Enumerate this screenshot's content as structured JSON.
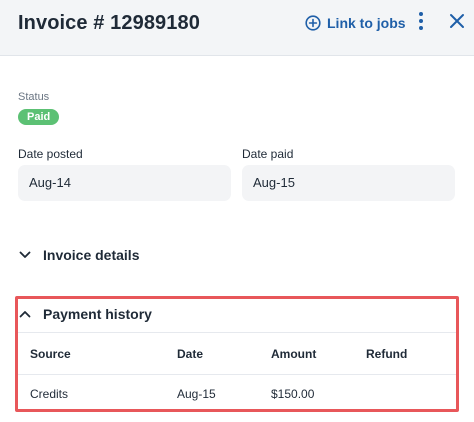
{
  "header": {
    "title": "Invoice # 12989180",
    "link_label": "Link to jobs",
    "icons": [
      "plus-circle-icon",
      "more-vertical-icon",
      "close-icon"
    ]
  },
  "status": {
    "label": "Status",
    "value": "Paid"
  },
  "dates": {
    "posted_label": "Date posted",
    "posted_value": "Aug-14",
    "paid_label": "Date paid",
    "paid_value": "Aug-15"
  },
  "sections": {
    "invoice_details": "Invoice details",
    "payment_history": "Payment history"
  },
  "payment_table": {
    "columns": [
      "Source",
      "Date",
      "Amount",
      "Refund"
    ],
    "rows": [
      [
        "Credits",
        "Aug-15",
        "$150.00",
        ""
      ]
    ]
  },
  "colors": {
    "accent": "#1f5fa8",
    "paid_badge": "#5cc174",
    "highlight": "#e8575a"
  }
}
